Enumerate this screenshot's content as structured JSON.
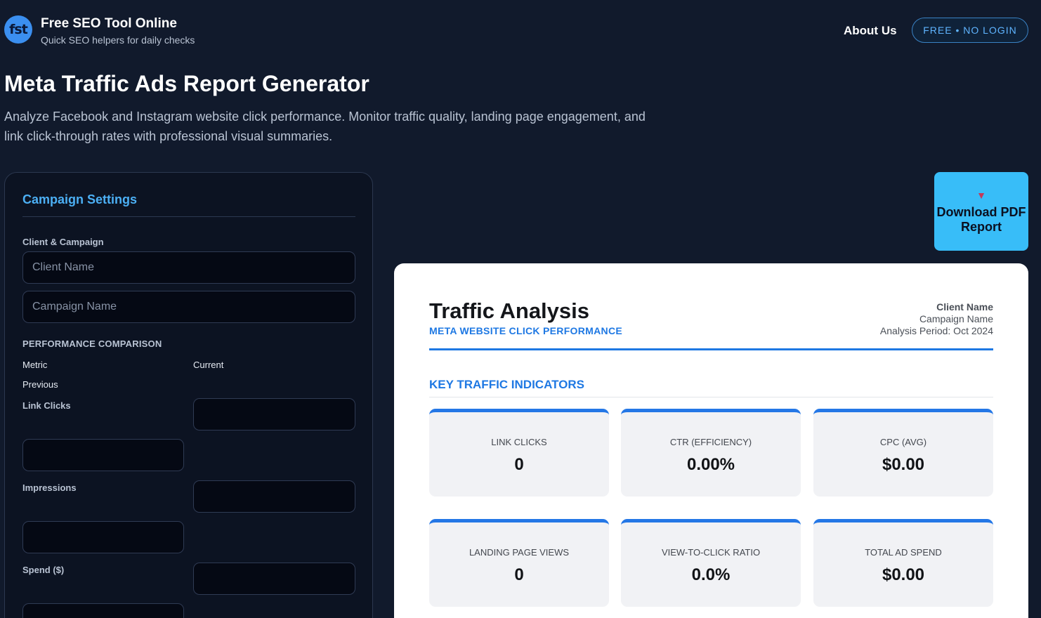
{
  "brand": {
    "logo_text": "fst",
    "title": "Free SEO Tool Online",
    "subtitle": "Quick SEO helpers for daily checks"
  },
  "nav": {
    "about": "About Us",
    "badge": "FREE • NO LOGIN"
  },
  "page": {
    "title": "Meta Traffic Ads Report Generator",
    "description": "Analyze Facebook and Instagram website click performance. Monitor traffic quality, landing page engagement, and link click-through rates with professional visual summaries."
  },
  "settings": {
    "title": "Campaign Settings",
    "client_section": "Client & Campaign",
    "client_placeholder": "Client Name",
    "campaign_placeholder": "Campaign Name",
    "comparison_title": "PERFORMANCE COMPARISON",
    "col_metric": "Metric",
    "col_current": "Current",
    "col_previous": "Previous",
    "metrics": [
      "Link Clicks",
      "Impressions",
      "Spend ($)"
    ]
  },
  "download": {
    "icon": "download-icon",
    "label": "Download PDF Report"
  },
  "report": {
    "title": "Traffic Analysis",
    "subtitle": "META WEBSITE CLICK PERFORMANCE",
    "client": "Client Name",
    "campaign": "Campaign Name",
    "period": "Analysis Period: Oct 2024",
    "section": "KEY TRAFFIC INDICATORS",
    "kpis": [
      {
        "label": "LINK CLICKS",
        "value": "0"
      },
      {
        "label": "CTR (EFFICIENCY)",
        "value": "0.00%"
      },
      {
        "label": "CPC (AVG)",
        "value": "$0.00"
      },
      {
        "label": "LANDING PAGE VIEWS",
        "value": "0"
      },
      {
        "label": "VIEW-TO-CLICK RATIO",
        "value": "0.0%"
      },
      {
        "label": "TOTAL AD SPEND",
        "value": "$0.00"
      }
    ],
    "accent_color": "#1e78e3"
  }
}
